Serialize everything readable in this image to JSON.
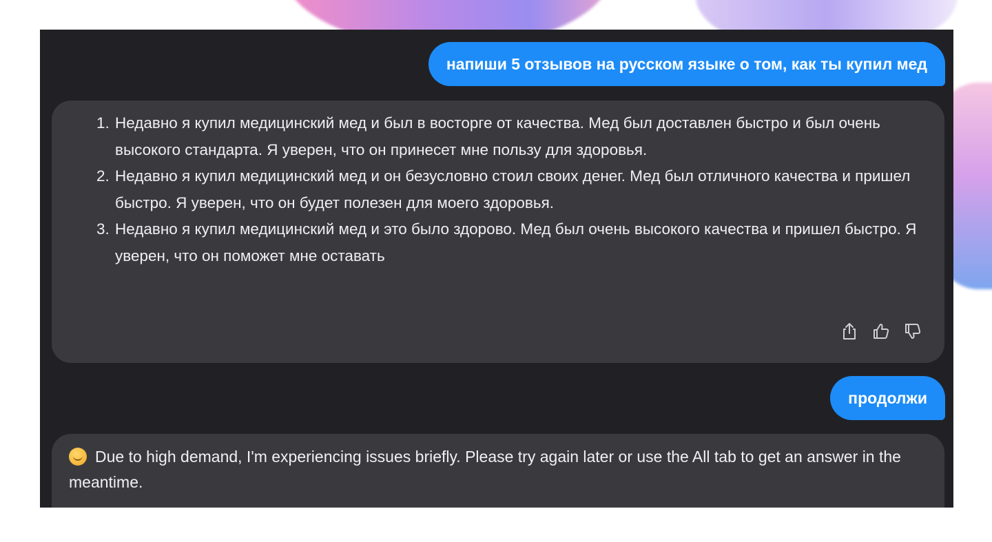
{
  "conversation": {
    "user_message_1": "напиши 5 отзывов на русском языке о том, как ты купил мед",
    "bot_reply_1": {
      "reviews": [
        "Недавно я купил медицинский мед и был в восторге от качества. Мед был доставлен быстро и был очень высокого стандарта. Я уверен, что он принесет мне пользу для здоровья.",
        "Недавно я купил медицинский мед и он безусловно стоил своих денег. Мед был отличного качества и пришел быстро. Я уверен, что он будет полезен для моего здоровья.",
        "Недавно я купил медицинский мед и это было здорово. Мед был очень высокого качества и пришел быстро. Я уверен, что он поможет мне оставать"
      ],
      "actions": [
        "share-icon",
        "thumbs-up-icon",
        "thumbs-down-icon"
      ]
    },
    "user_message_2": "продолжи",
    "bot_reply_2": {
      "emoji": "sad-face-emoji",
      "text": "Due to high demand, I'm experiencing issues briefly. Please try again later or use the All tab to get an answer in the meantime."
    }
  },
  "colors": {
    "panel_bg": "#212125",
    "bot_bubble_bg": "#3a3a3e",
    "user_bubble_bg": "#1d8cf8",
    "text": "#f0f0f2"
  }
}
